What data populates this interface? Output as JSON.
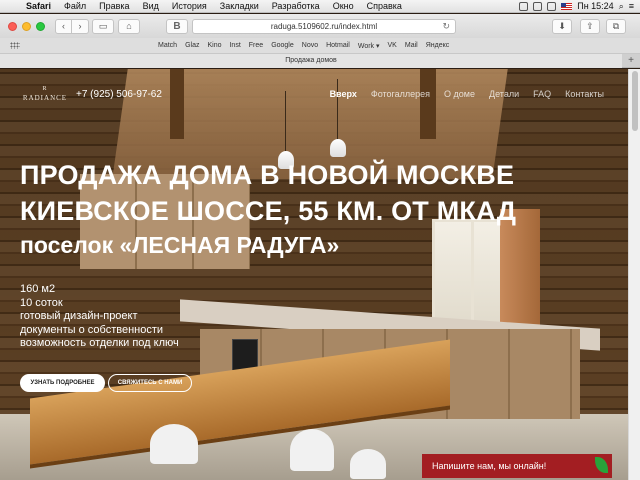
{
  "menubar": {
    "apple": "",
    "items": [
      "Safari",
      "Файл",
      "Правка",
      "Вид",
      "История",
      "Закладки",
      "Разработка",
      "Окно",
      "Справка"
    ],
    "clock": "Пн 15:24"
  },
  "toolbar": {
    "back": "‹",
    "forward": "›",
    "bookmark_letter": "B",
    "url": "raduga.5109602.ru/index.html",
    "reload": "↻"
  },
  "favorites": [
    "Match",
    "Glaz",
    "Kino",
    "Inst",
    "Free",
    "Google",
    "Novo",
    "Hotmail",
    "Work ▾",
    "VK",
    "Mail",
    "Яндекс"
  ],
  "tab": {
    "title": "Продажа домов",
    "new_tab": "+"
  },
  "site": {
    "logo_mark": "R",
    "logo_word": "RADIANCE",
    "phone": "+7 (925) 506-97-62",
    "menu": [
      "Вверх",
      "Фотогаллерея",
      "О доме",
      "Детали",
      "FAQ",
      "Контакты"
    ],
    "headline": {
      "line1": "ПРОДАЖА ДОМА В НОВОЙ МОСКВЕ",
      "line2": "КИЕВСКОЕ ШОССЕ, 55 КМ. ОТ МКАД",
      "line3": "поселок «ЛЕСНАЯ РАДУГА»"
    },
    "facts": [
      "160 м2",
      "10 соток",
      "готовый дизайн-проект",
      "документы о собственности",
      "возможность отделки под ключ"
    ],
    "button_primary": "УЗНАТЬ ПОДРОБНЕЕ",
    "button_secondary": "СВЯЖИТЕСЬ С НАМИ",
    "chat": "Напишите нам, мы онлайн!"
  },
  "colors": {
    "chat_bg": "#a31e22",
    "chat_leaf": "#29a33a"
  }
}
